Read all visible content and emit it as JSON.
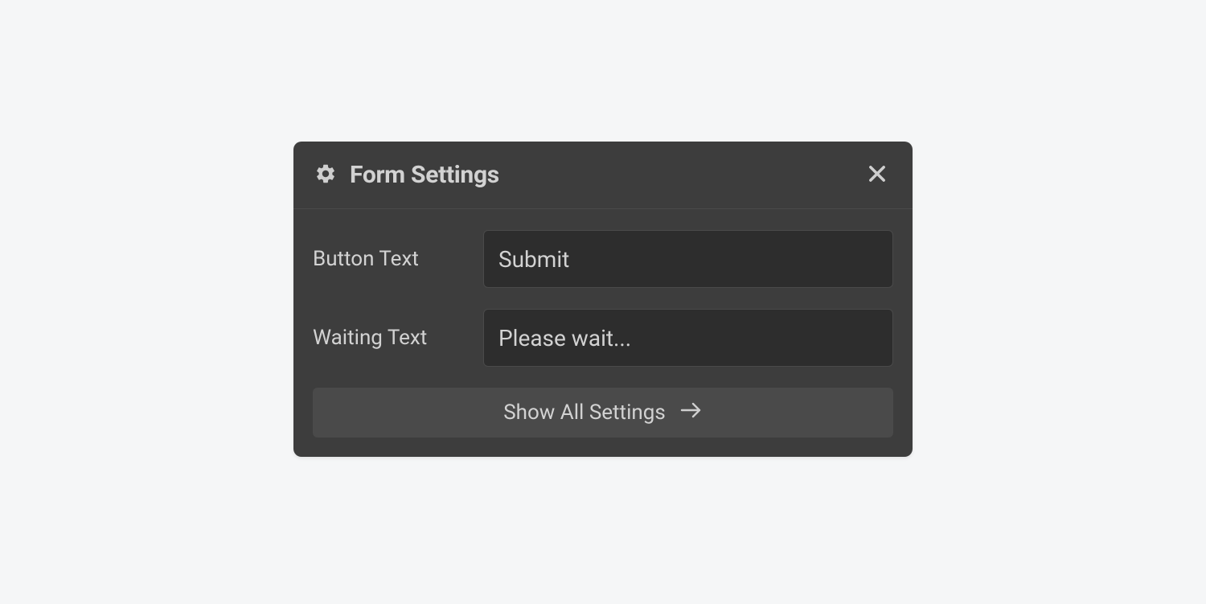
{
  "panel": {
    "title": "Form Settings",
    "fields": {
      "button_text": {
        "label": "Button Text",
        "value": "Submit"
      },
      "waiting_text": {
        "label": "Waiting Text",
        "value": "Please wait..."
      }
    },
    "show_all_label": "Show All Settings"
  }
}
